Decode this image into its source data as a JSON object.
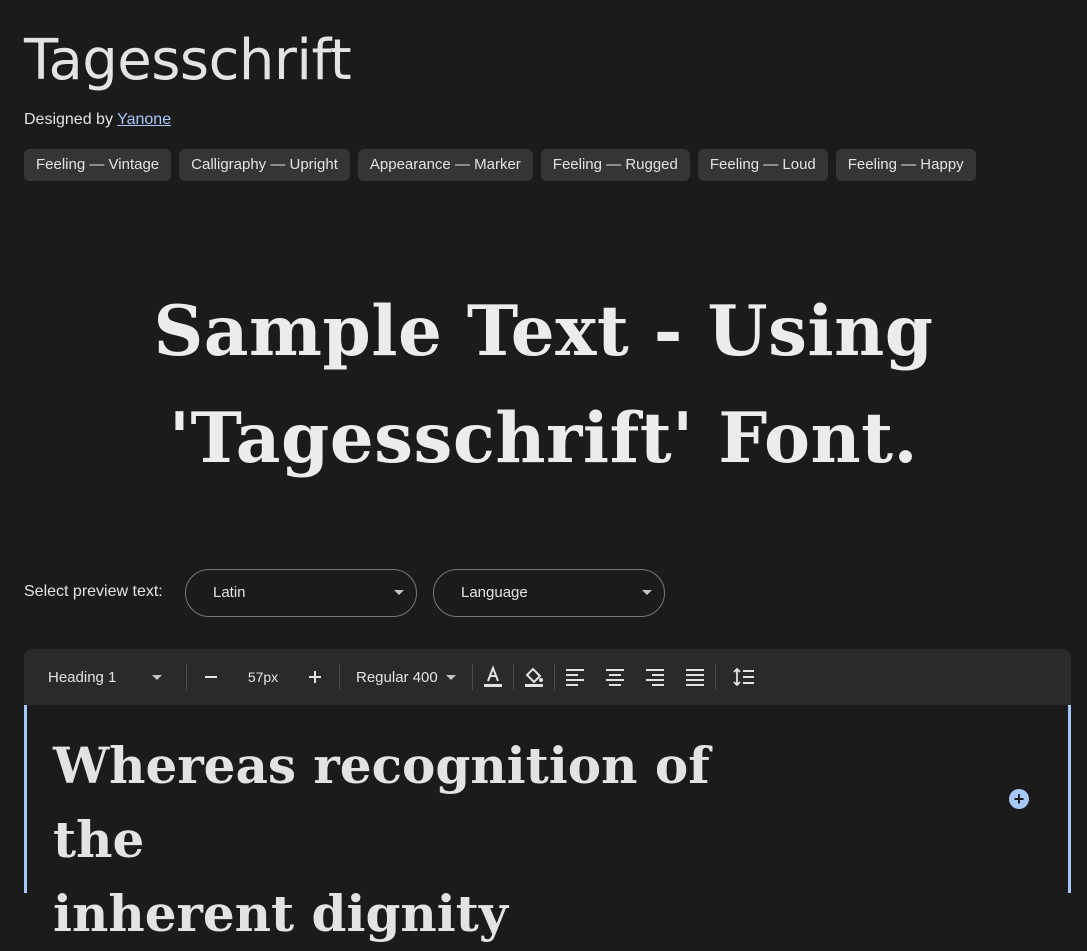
{
  "header": {
    "title": "Tagesschrift",
    "designed_by_prefix": "Designed by",
    "designer_name": "Yanone"
  },
  "tags": [
    "Feeling — Vintage",
    "Calligraphy — Upright",
    "Appearance — Marker",
    "Feeling — Rugged",
    "Feeling — Loud",
    "Feeling — Happy"
  ],
  "sample": {
    "line1": "Sample Text - Using",
    "line2": "'Tagesschrift' Font."
  },
  "preview": {
    "label": "Select preview text:",
    "script_value": "Latin",
    "language_placeholder": "Language"
  },
  "toolbar": {
    "text_style": "Heading 1",
    "decrease_icon": "minus-icon",
    "font_size": "57px",
    "increase_icon": "plus-icon",
    "weight": "Regular 400",
    "icons": [
      "text-color-icon",
      "fill-color-icon",
      "align-left-icon",
      "align-center-icon",
      "align-right-icon",
      "align-justify-icon",
      "line-height-icon"
    ]
  },
  "editor": {
    "text_line1": "Whereas recognition of the",
    "text_line2": "inherent dignity"
  },
  "colors": {
    "background": "#1b1b1b",
    "accent": "#a8c7fa",
    "tag_bg": "#333537"
  }
}
